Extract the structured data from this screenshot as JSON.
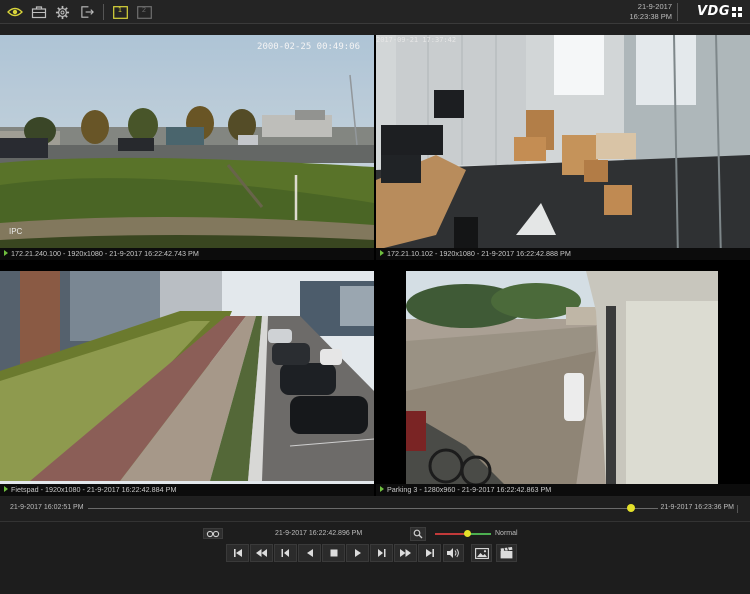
{
  "topbar": {
    "icons": [
      "eye-icon",
      "briefcase-icon",
      "gear-icon",
      "logout-icon",
      "layout-1-icon",
      "layout-2-icon"
    ],
    "layout_1_label": "1",
    "layout_2_label": "2",
    "date": "21-9-2017",
    "time": "16:23:38 PM",
    "logo": "VDG"
  },
  "cameras": [
    {
      "id": "cam1",
      "status": "172.21.240.100 - 1920x1080 - 21-9-2017 16:22:42.743 PM",
      "overlay_timestamp": "2000-02-25 00:49:06",
      "label": "IPC"
    },
    {
      "id": "cam2",
      "status": "172.21.10.102 - 1920x1080 - 21-9-2017 16:22:42.888 PM",
      "overlay_timestamp": "2017-09-21 17:37:42"
    },
    {
      "id": "cam3",
      "status": "Fietspad - 1920x1080 - 21-9-2017 16:22:42.884 PM"
    },
    {
      "id": "cam4",
      "status": "Parking 3 - 1280x960 - 21-9-2017 16:22:42.863 PM"
    }
  ],
  "timeline": {
    "start": "21-9-2017 16:02:51 PM",
    "end": "21-9-2017 16:23:36 PM",
    "position": 0.953
  },
  "controls": {
    "current_time": "21-9-2017 16:22:42.896 PM",
    "speed_label": "Normal",
    "speed_position": 0.5,
    "buttons": [
      "skip-start-icon",
      "rewind-icon",
      "step-back-icon",
      "play-reverse-icon",
      "stop-icon",
      "play-icon",
      "step-forward-icon",
      "fast-forward-icon",
      "skip-end-icon"
    ]
  },
  "colors": {
    "accent": "#e3e02a",
    "play_indicator": "#6fbf3f",
    "speed_slow": "#c23a3a",
    "speed_fast": "#4caf50"
  }
}
